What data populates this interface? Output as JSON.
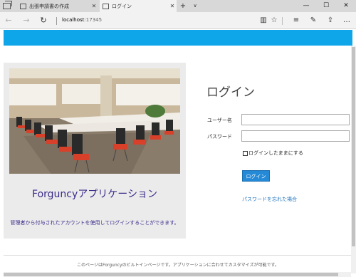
{
  "browser": {
    "tabs": [
      {
        "label": "出張申請書の作成",
        "close": "✕"
      },
      {
        "label": "ログイン",
        "close": "✕"
      }
    ],
    "new_tab": "+",
    "tab_menu": "∨",
    "window_buttons": {
      "minimize": "—",
      "maximize": "☐",
      "close": "✕"
    },
    "nav": {
      "back": "←",
      "forward": "→",
      "refresh": "↻"
    },
    "url_host": "localhost",
    "url_port": ":17345",
    "toolbar": {
      "reading_view": "▥",
      "favorite": "☆",
      "hub": "≡",
      "notes": "✎",
      "share": "⇪",
      "more": "…"
    }
  },
  "login": {
    "app_name": "Forguncyアプリケーション",
    "app_description": "管理者から付与されたアカウントを使用してログインすることができます。",
    "title": "ログイン",
    "username_label": "ユーザー名",
    "username_value": "",
    "password_label": "パスワード",
    "password_value": "",
    "remember_label": "ログインしたままにする",
    "remember_checked": false,
    "submit_label": "ログイン",
    "forgot_link": "パスワードを忘れた場合"
  },
  "footer": {
    "text": "このページはForguncyのビルトインページです。アプリケーションに合わせてカスタマイズが可能です。"
  },
  "colors": {
    "header_bar": "#0ea5e9",
    "app_name": "#3b2b8a",
    "button": "#2489d6",
    "link": "#1e73be"
  }
}
